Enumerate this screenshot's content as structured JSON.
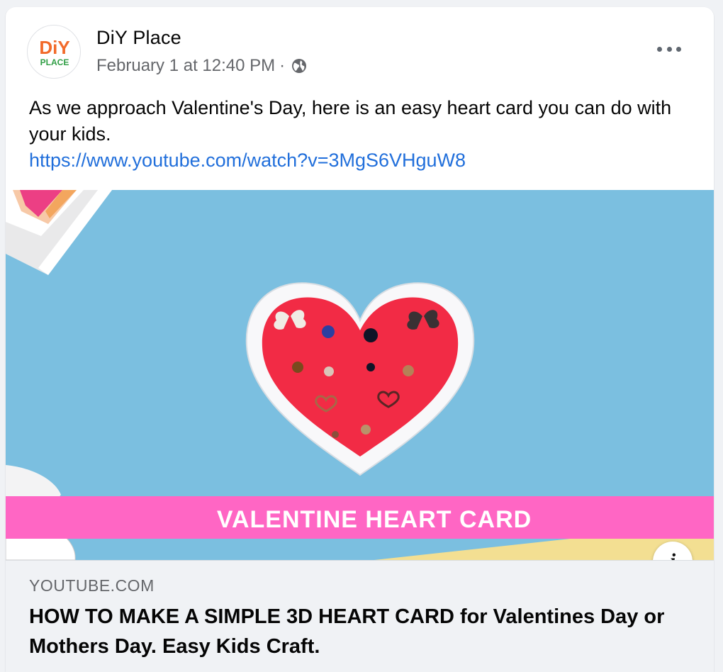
{
  "post": {
    "page_name": "DiY Place",
    "avatar_logo_text": "DiY PLACE",
    "timestamp": "February 1 at 12:40 PM",
    "separator": "·",
    "audience_icon": "globe-icon",
    "more_icon": "more-options-icon",
    "text": "As we approach Valentine's Day, here is an easy heart card you can do with your kids.",
    "link_url": "https://www.youtube.com/watch?v=3MgS6VHguW8"
  },
  "preview": {
    "banner_text": "VALENTINE HEART CARD",
    "info_icon": "info-icon",
    "info_label": "i",
    "domain": "YOUTUBE.COM",
    "title": "HOW TO MAKE A SIMPLE 3D HEART CARD for Valentines Day or Mothers Day. Easy Kids Craft."
  },
  "colors": {
    "link": "#216fdb",
    "secondary_text": "#65676b",
    "banner_pink": "#ff66c4",
    "heart_red": "#f22b45",
    "background_blue": "#7bbfe0"
  }
}
